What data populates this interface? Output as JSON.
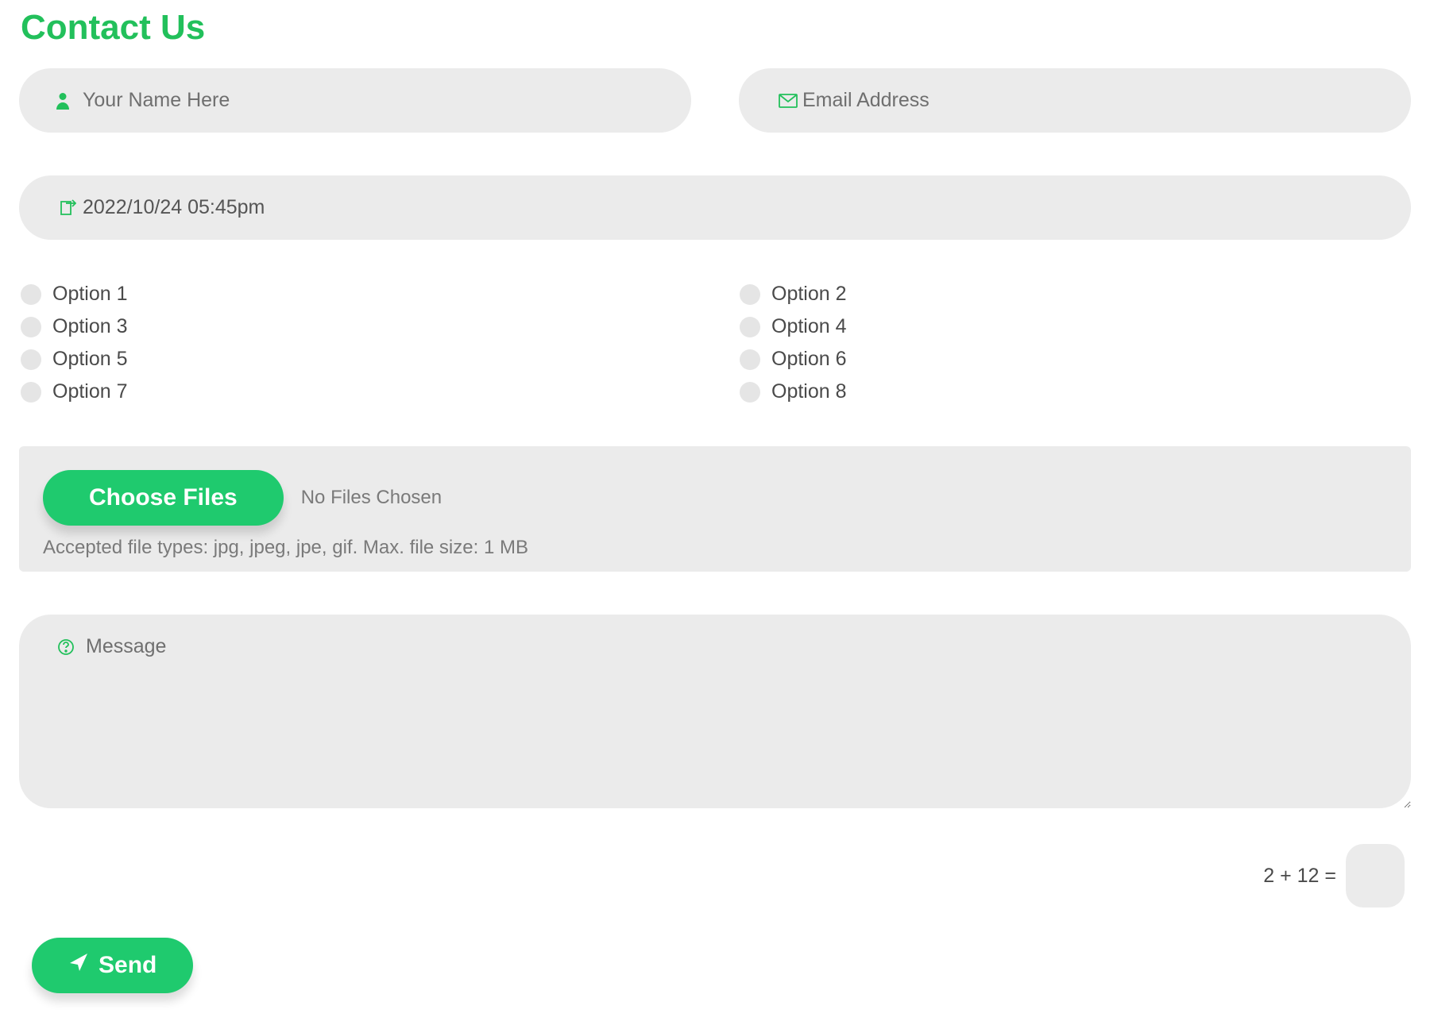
{
  "title": "Contact Us",
  "name_field": {
    "placeholder": "Your Name Here",
    "value": ""
  },
  "email_field": {
    "placeholder": "Email Address",
    "value": ""
  },
  "datetime_field": {
    "placeholder": "",
    "value": "2022/10/24 05:45pm"
  },
  "checkboxes": {
    "options": [
      "Option 1",
      "Option 2",
      "Option 3",
      "Option 4",
      "Option 5",
      "Option 6",
      "Option 7",
      "Option 8"
    ]
  },
  "upload": {
    "button_label": "Choose Files",
    "status": "No Files Chosen",
    "hint": "Accepted file types: jpg, jpeg, jpe, gif. Max. file size: 1 MB"
  },
  "message_field": {
    "placeholder": "Message",
    "value": ""
  },
  "captcha": {
    "question": "2 + 12 =",
    "value": ""
  },
  "submit_label": "Send"
}
